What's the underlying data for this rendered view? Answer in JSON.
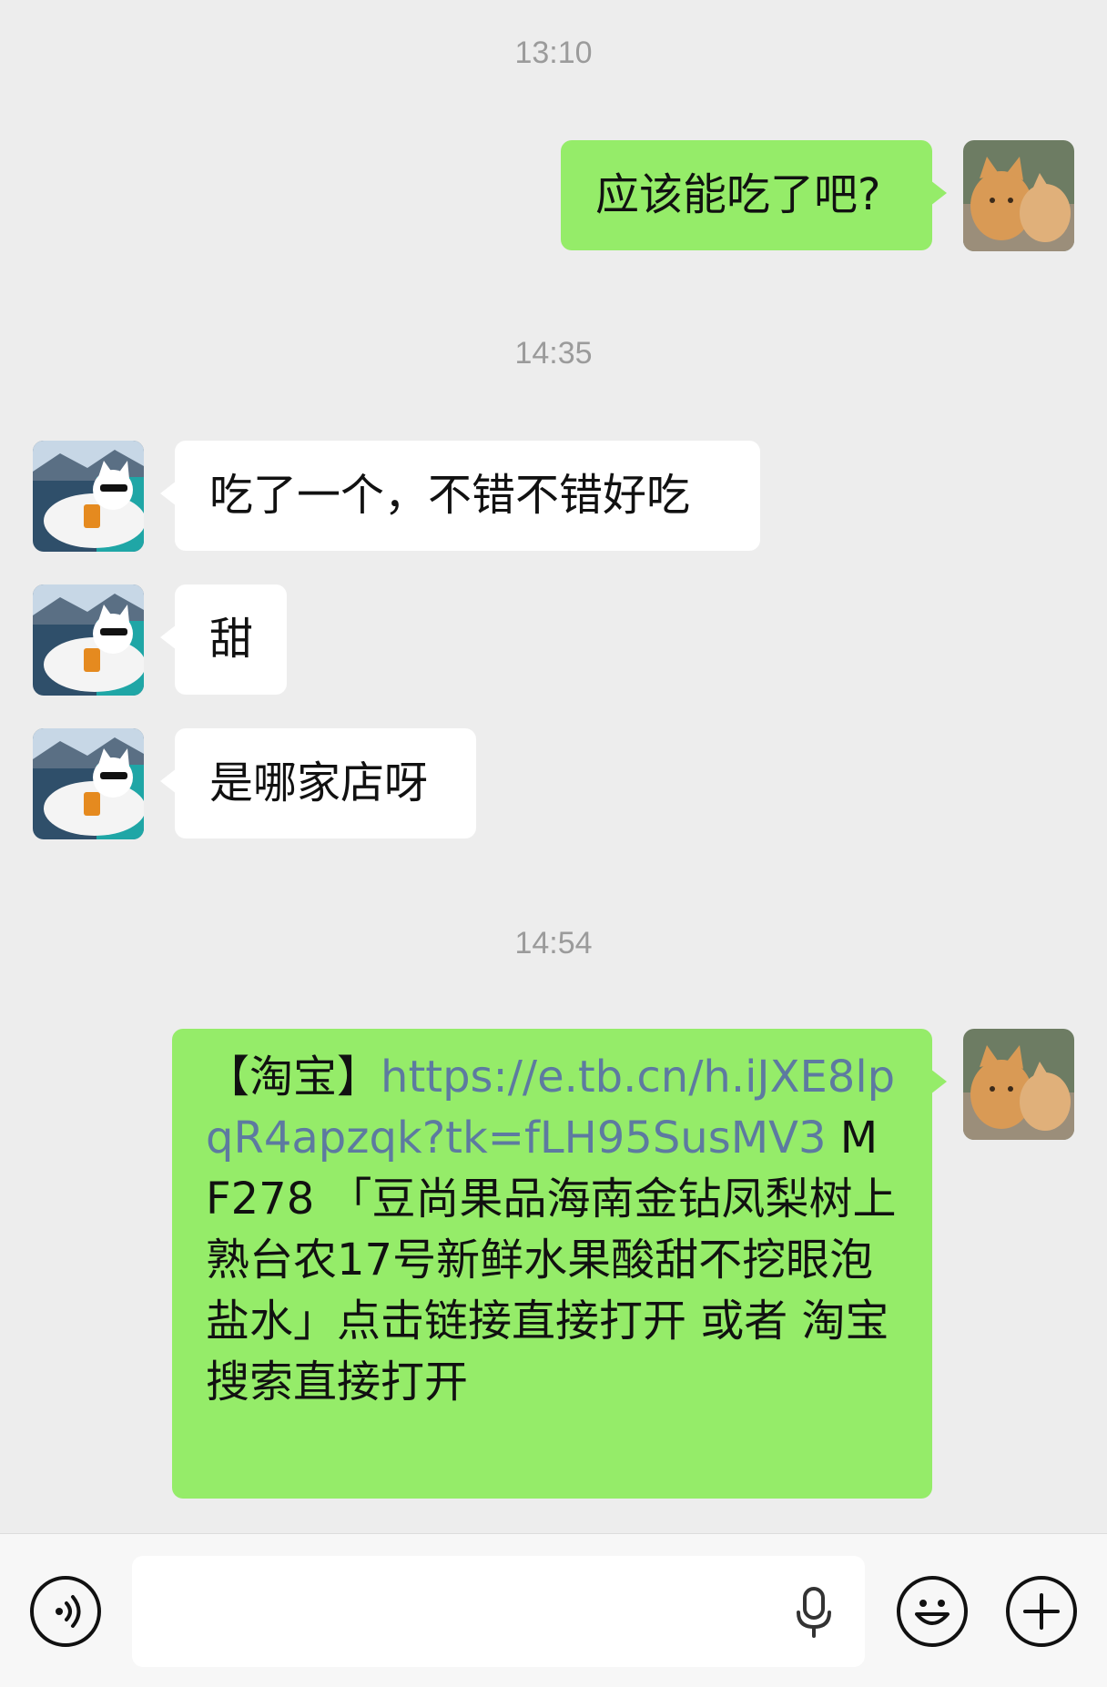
{
  "messages": {
    "time1": "13:10",
    "m1": "应该能吃了吧?",
    "time2": "14:35",
    "m2": "吃了一个，不错不错好吃",
    "m3": "甜",
    "m4": "是哪家店呀",
    "time3": "14:54",
    "m5": {
      "prefix": "【淘宝】",
      "link": "https://e.tb.cn/h.iJXE8lpqR4apzqk?tk=fLH95SusMV3",
      "text": " MF278 「豆尚果品海南金钻凤梨树上熟台农17号新鲜水果酸甜不挖眼泡盐水」点击链接直接打开 或者 淘宝搜索直接打开"
    }
  },
  "colors": {
    "self_bubble": "#95ec69",
    "other_bubble": "#ffffff",
    "link": "#5d7aa0",
    "background": "#ededed"
  },
  "icons": {
    "voice": "voice-toggle-icon",
    "mic": "microphone-icon",
    "emoji": "emoji-icon",
    "more": "plus-icon"
  }
}
